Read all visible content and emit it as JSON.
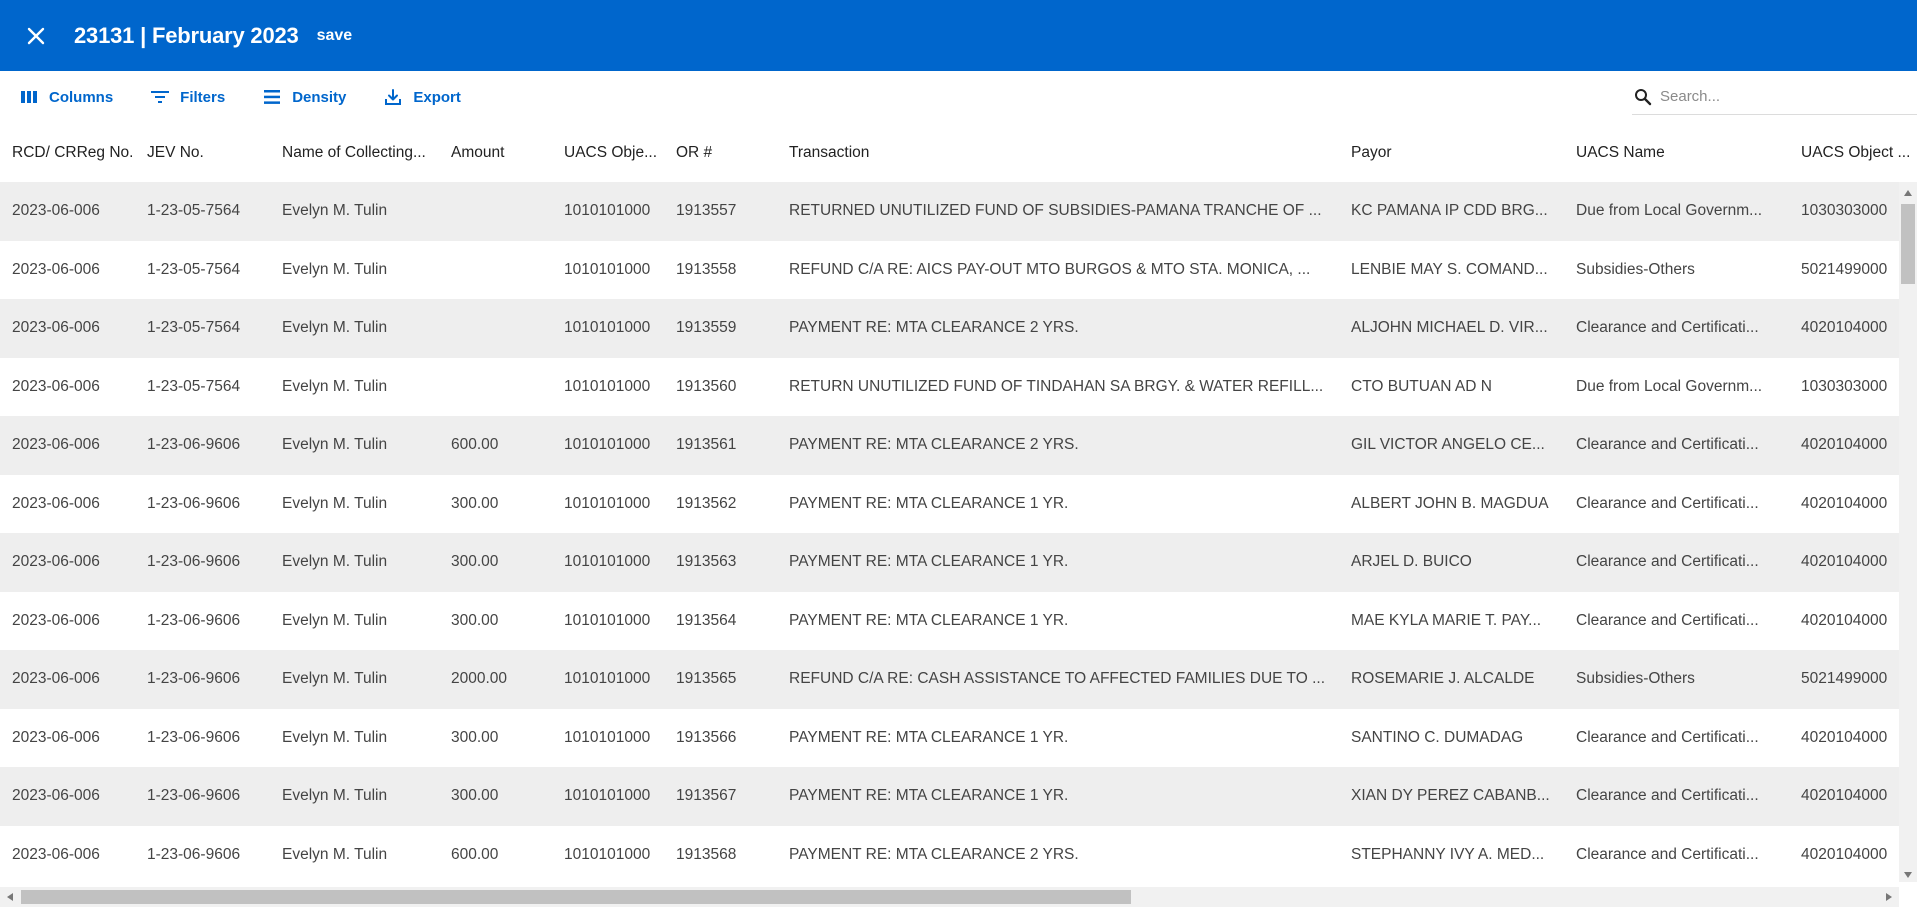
{
  "appbar": {
    "title": "23131 | February 2023",
    "save_label": "save"
  },
  "toolbar": {
    "buttons": [
      {
        "label": "Columns",
        "icon": "columns-icon"
      },
      {
        "label": "Filters",
        "icon": "filter-icon"
      },
      {
        "label": "Density",
        "icon": "density-icon"
      },
      {
        "label": "Export",
        "icon": "export-icon"
      }
    ],
    "search_placeholder": "Search..."
  },
  "grid": {
    "columns": [
      "RCD/ CRReg No.",
      "JEV No.",
      "Name of Collecting...",
      "Amount",
      "UACS Obje...",
      "OR #",
      "Transaction",
      "Payor",
      "UACS Name",
      "UACS Object ..."
    ],
    "rows": [
      [
        "2023-06-006",
        "1-23-05-7564",
        "Evelyn M. Tulin",
        "",
        "1010101000",
        "1913557",
        "RETURNED UNUTILIZED FUND OF SUBSIDIES-PAMANA TRANCHE OF ...",
        "KC PAMANA IP CDD BRG...",
        "Due from Local Governm...",
        "1030303000"
      ],
      [
        "2023-06-006",
        "1-23-05-7564",
        "Evelyn M. Tulin",
        "",
        "1010101000",
        "1913558",
        "REFUND C/A RE: AICS PAY-OUT MTO BURGOS & MTO STA. MONICA, ...",
        "LENBIE MAY S. COMAND...",
        "Subsidies-Others",
        "5021499000"
      ],
      [
        "2023-06-006",
        "1-23-05-7564",
        "Evelyn M. Tulin",
        "",
        "1010101000",
        "1913559",
        "PAYMENT RE: MTA CLEARANCE 2 YRS.",
        "ALJOHN MICHAEL D. VIR...",
        "Clearance and Certificati...",
        "4020104000"
      ],
      [
        "2023-06-006",
        "1-23-05-7564",
        "Evelyn M. Tulin",
        "",
        "1010101000",
        "1913560",
        "RETURN UNUTILIZED FUND OF TINDAHAN SA BRGY. & WATER REFILL...",
        "CTO BUTUAN AD N",
        "Due from Local Governm...",
        "1030303000"
      ],
      [
        "2023-06-006",
        "1-23-06-9606",
        "Evelyn M. Tulin",
        "600.00",
        "1010101000",
        "1913561",
        "PAYMENT RE: MTA CLEARANCE 2 YRS.",
        "GIL VICTOR ANGELO CE...",
        "Clearance and Certificati...",
        "4020104000"
      ],
      [
        "2023-06-006",
        "1-23-06-9606",
        "Evelyn M. Tulin",
        "300.00",
        "1010101000",
        "1913562",
        "PAYMENT RE: MTA CLEARANCE 1 YR.",
        "ALBERT JOHN B. MAGDUA",
        "Clearance and Certificati...",
        "4020104000"
      ],
      [
        "2023-06-006",
        "1-23-06-9606",
        "Evelyn M. Tulin",
        "300.00",
        "1010101000",
        "1913563",
        "PAYMENT RE: MTA CLEARANCE 1 YR.",
        "ARJEL D. BUICO",
        "Clearance and Certificati...",
        "4020104000"
      ],
      [
        "2023-06-006",
        "1-23-06-9606",
        "Evelyn M. Tulin",
        "300.00",
        "1010101000",
        "1913564",
        "PAYMENT RE: MTA CLEARANCE 1 YR.",
        "MAE KYLA MARIE T. PAY...",
        "Clearance and Certificati...",
        "4020104000"
      ],
      [
        "2023-06-006",
        "1-23-06-9606",
        "Evelyn M. Tulin",
        "2000.00",
        "1010101000",
        "1913565",
        "REFUND C/A RE: CASH ASSISTANCE TO AFFECTED FAMILIES DUE TO ...",
        "ROSEMARIE J. ALCALDE",
        "Subsidies-Others",
        "5021499000"
      ],
      [
        "2023-06-006",
        "1-23-06-9606",
        "Evelyn M. Tulin",
        "300.00",
        "1010101000",
        "1913566",
        "PAYMENT RE: MTA CLEARANCE 1 YR.",
        "SANTINO C. DUMADAG",
        "Clearance and Certificati...",
        "4020104000"
      ],
      [
        "2023-06-006",
        "1-23-06-9606",
        "Evelyn M. Tulin",
        "300.00",
        "1010101000",
        "1913567",
        "PAYMENT RE: MTA CLEARANCE 1 YR.",
        "XIAN DY PEREZ CABANB...",
        "Clearance and Certificati...",
        "4020104000"
      ],
      [
        "2023-06-006",
        "1-23-06-9606",
        "Evelyn M. Tulin",
        "600.00",
        "1010101000",
        "1913568",
        "PAYMENT RE: MTA CLEARANCE 2 YRS.",
        "STEPHANNY IVY A. MED...",
        "Clearance and Certificati...",
        "4020104000"
      ]
    ]
  },
  "colors": {
    "primary": "#0066cc",
    "row_shaded": "#eeeeee"
  }
}
